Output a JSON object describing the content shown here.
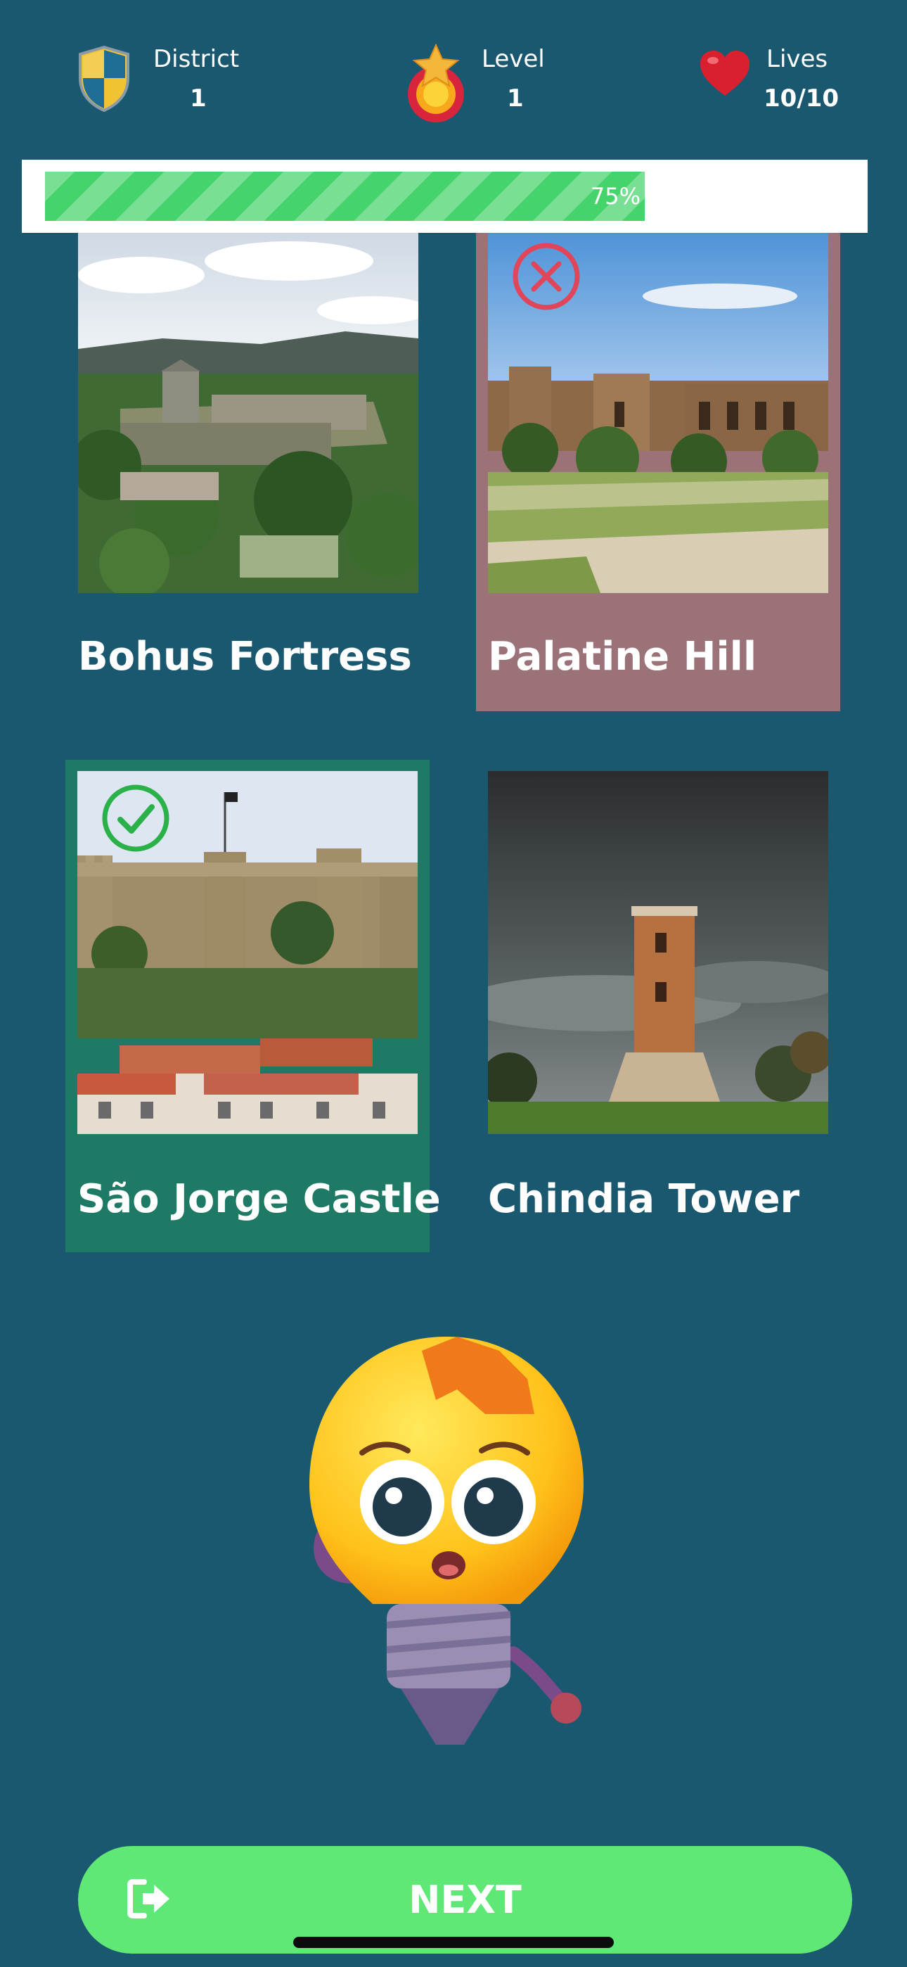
{
  "header": {
    "district": {
      "label": "District",
      "value": "1",
      "icon": "shield-icon"
    },
    "level": {
      "label": "Level",
      "value": "1",
      "icon": "star-medal-icon"
    },
    "lives": {
      "label": "Lives",
      "value": "10/10",
      "icon": "heart-icon"
    }
  },
  "progress": {
    "value": 0.75,
    "label": "75%"
  },
  "cards": [
    {
      "name": "Bohus Fortress",
      "state": "neutral",
      "image": "fortress-photo"
    },
    {
      "name": "Palatine Hill",
      "state": "incorrect",
      "image": "ruins-photo",
      "mark": "x-circle-icon"
    },
    {
      "name": "São Jorge Castle",
      "state": "correct",
      "image": "castle-photo",
      "mark": "check-circle-icon"
    },
    {
      "name": "Chindia Tower",
      "state": "neutral",
      "image": "tower-photo"
    }
  ],
  "colors": {
    "background": "#1a5870",
    "correct": "#1e7a64",
    "incorrect": "#9a7278",
    "progress": "#45d36c",
    "button": "#5fe876"
  },
  "mascot": "lightbulb-mascot",
  "next_button": {
    "label": "NEXT",
    "icon": "exit-arrow-icon"
  }
}
